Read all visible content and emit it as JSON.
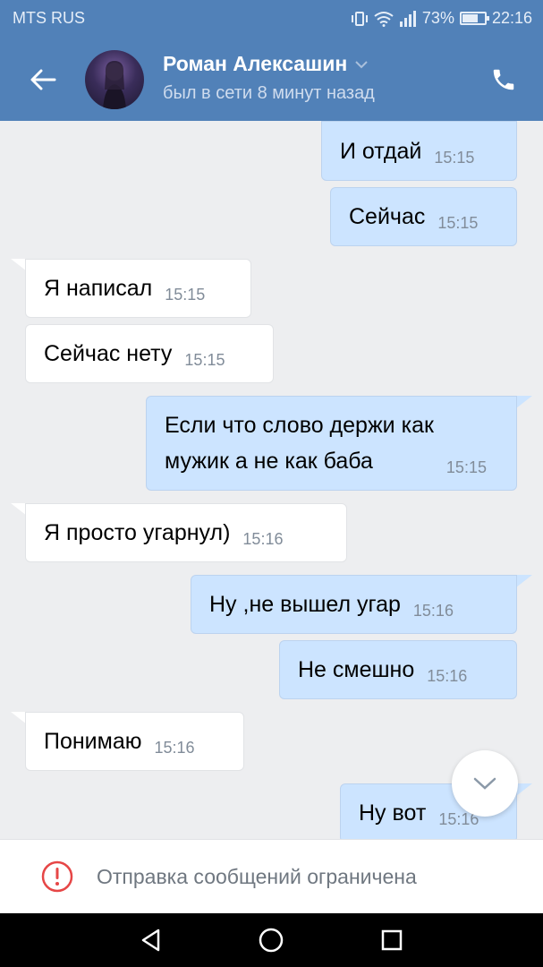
{
  "status_bar": {
    "carrier": "MTS RUS",
    "signal_icon": "signal-icon",
    "battery_percent": "73%",
    "battery_level": 0.73,
    "time": "22:16"
  },
  "header": {
    "name": "Роман Алексашин",
    "last_seen": "был в сети 8 минут назад"
  },
  "messages": [
    {
      "dir": "out",
      "text": "И отдай",
      "time": "15:15"
    },
    {
      "dir": "out",
      "text": "Сейчас",
      "time": "15:15"
    },
    {
      "dir": "in",
      "text": "Я написал",
      "time": "15:15"
    },
    {
      "dir": "in",
      "text": "Сейчас нету",
      "time": "15:15"
    },
    {
      "dir": "out",
      "text": "Если что слово держи как\nмужик а не как баба",
      "time": "15:15"
    },
    {
      "dir": "in",
      "text": "Я просто угарнул)",
      "time": "15:16"
    },
    {
      "dir": "out",
      "text": "Ну ,не вышел угар",
      "time": "15:16"
    },
    {
      "dir": "out",
      "text": "Не смешно",
      "time": "15:16"
    },
    {
      "dir": "in",
      "text": "Понимаю",
      "time": "15:16"
    },
    {
      "dir": "out",
      "text": "Ну вот",
      "time": "15:16"
    }
  ],
  "footer": {
    "notice": "Отправка сообщений ограничена"
  },
  "colors": {
    "header": "#5181b8",
    "outgoing": "#cce4ff",
    "incoming": "#ffffff",
    "background": "#edeef0",
    "warning": "#e64646"
  }
}
